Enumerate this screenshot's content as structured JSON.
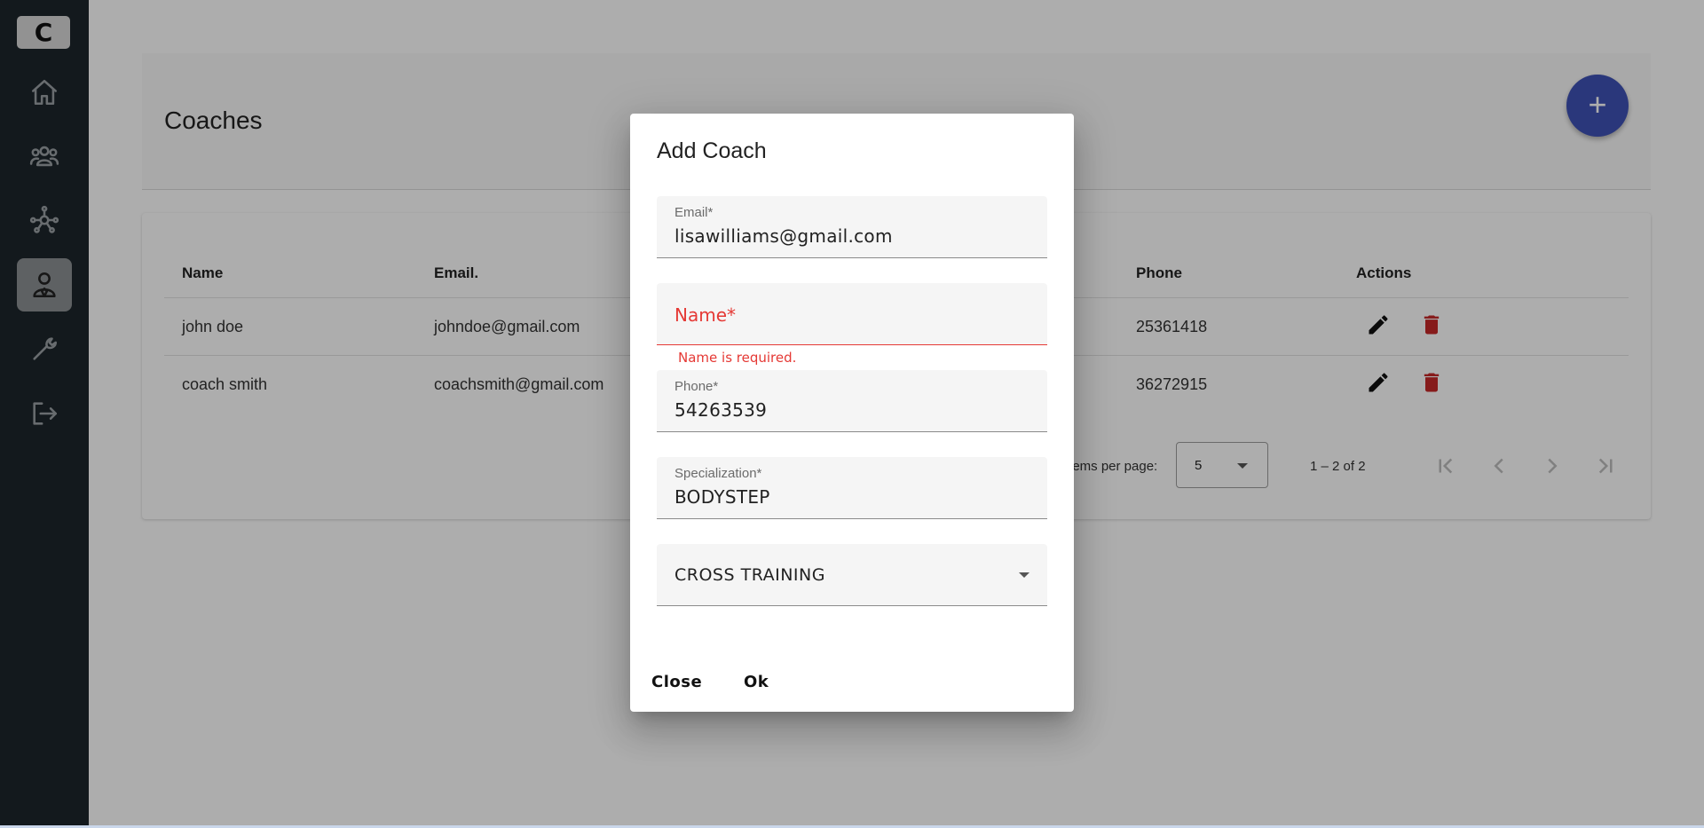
{
  "sidebar": {
    "logo": "C",
    "items": [
      {
        "name": "home",
        "icon": "home-icon"
      },
      {
        "name": "members",
        "icon": "people-icon"
      },
      {
        "name": "network",
        "icon": "hub-icon"
      },
      {
        "name": "coaches",
        "icon": "coach-icon",
        "active": true
      },
      {
        "name": "equipment",
        "icon": "wrench-icon"
      },
      {
        "name": "logout",
        "icon": "logout-icon"
      }
    ]
  },
  "page": {
    "title": "Coaches",
    "add_button": "+"
  },
  "table": {
    "columns": [
      "Name",
      "Email.",
      "Phone",
      "Actions"
    ],
    "rows": [
      {
        "name": "john doe",
        "email": "johndoe@gmail.com",
        "phone": "25361418"
      },
      {
        "name": "coach smith",
        "email": "coachsmith@gmail.com",
        "phone": "36272915"
      }
    ]
  },
  "paginator": {
    "label": "Items per page:",
    "page_size": "5",
    "range": "1 – 2 of 2"
  },
  "dialog": {
    "title": "Add Coach",
    "email": {
      "label": "Email*",
      "value": "lisawilliams@gmail.com"
    },
    "name": {
      "label": "Name*",
      "value": "",
      "error": "Name is required."
    },
    "phone": {
      "label": "Phone*",
      "value": "54263539"
    },
    "specialization": {
      "label": "Specialization*",
      "value": "BODYSTEP"
    },
    "category": {
      "value": "CROSS TRAINING"
    },
    "close_label": "Close",
    "ok_label": "Ok"
  },
  "colors": {
    "sidebar": "#1c252b",
    "accent": "#3f51b5",
    "error": "#e53935",
    "delete": "#c62828"
  }
}
